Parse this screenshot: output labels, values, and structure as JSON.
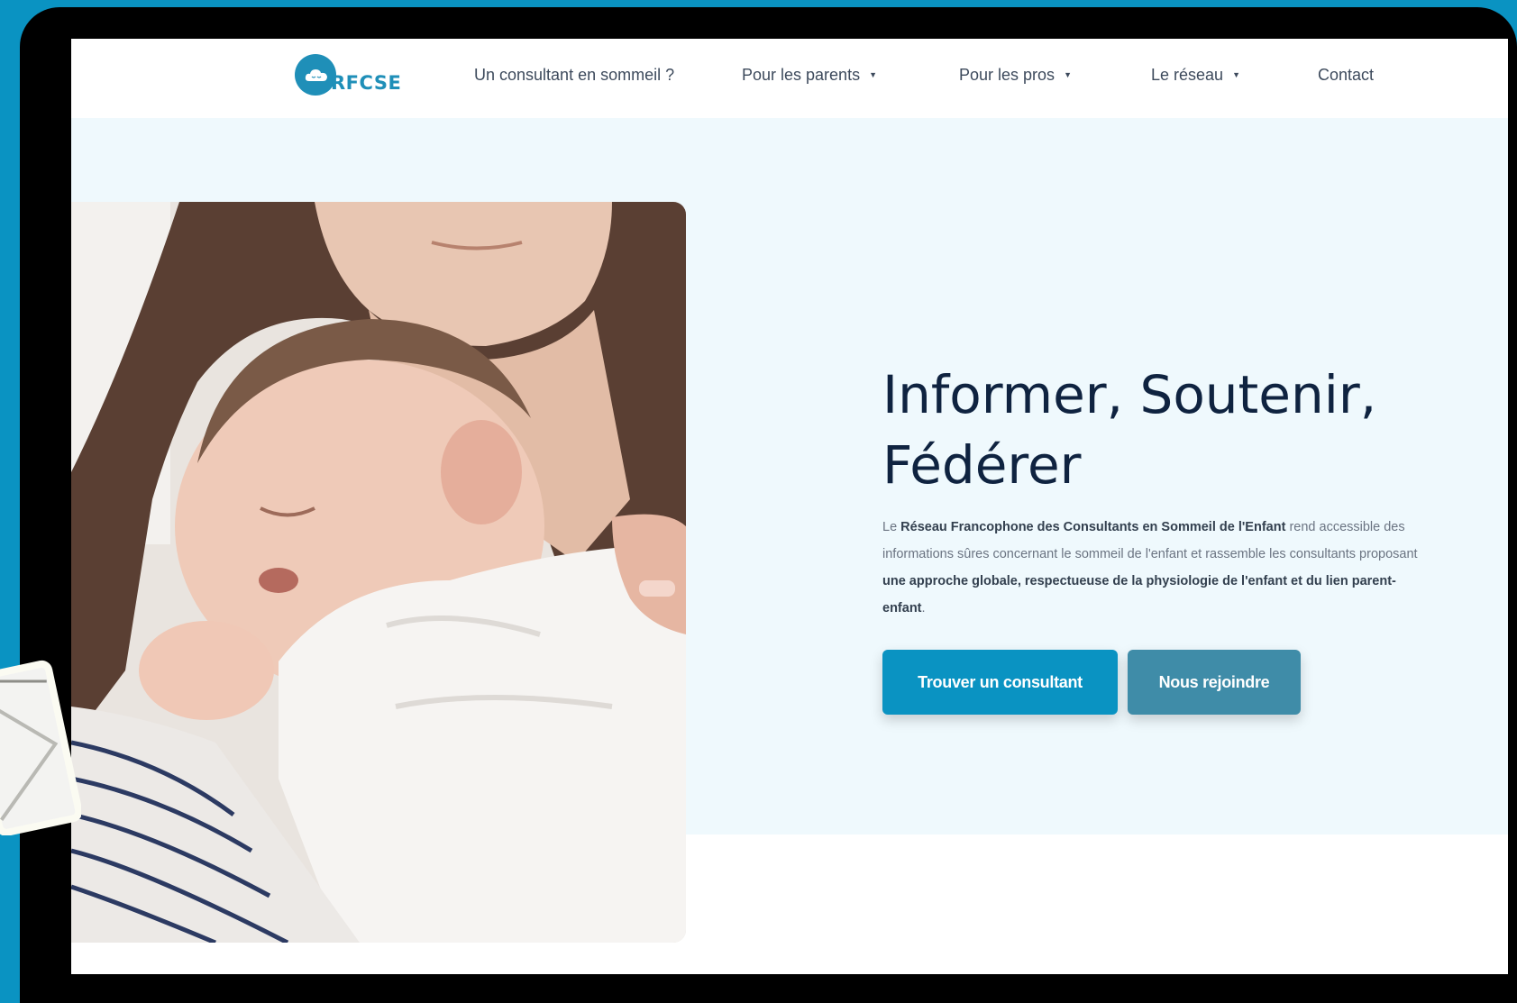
{
  "nav": {
    "logo_text": "RFCSE",
    "items": [
      {
        "label": "Un consultant en sommeil ?",
        "has_dropdown": false
      },
      {
        "label": "Pour les parents",
        "has_dropdown": true
      },
      {
        "label": "Pour les pros",
        "has_dropdown": true
      },
      {
        "label": "Le réseau",
        "has_dropdown": true
      },
      {
        "label": "Contact",
        "has_dropdown": false
      }
    ],
    "caret_glyph": "▼"
  },
  "hero": {
    "title_line1": "Informer, Soutenir,",
    "title_line2": "Fédérer",
    "text": {
      "t1": "Le ",
      "b1": "Réseau Francophone des Consultants en Sommeil de l'Enfant",
      "t2": " rend accessible des informations sûres concernant le sommeil de l'enfant et rassemble les consultants proposant ",
      "b2": "une approche globale, respectueuse de la physiologie de l'enfant et du lien parent-enfant",
      "t3": "."
    },
    "primary_button": "Trouver un consultant",
    "secondary_button": "Nous rejoindre"
  },
  "colors": {
    "frame": "#0a93c2",
    "accent": "#0a93c2",
    "secondary_button": "#3f8ca8",
    "hero_background": "#eff9fd",
    "title": "#0f2340"
  },
  "icons": {
    "logo": "cloud-logo-icon",
    "envelope": "envelope-icon",
    "photo": "baby-sleeping-photo"
  }
}
